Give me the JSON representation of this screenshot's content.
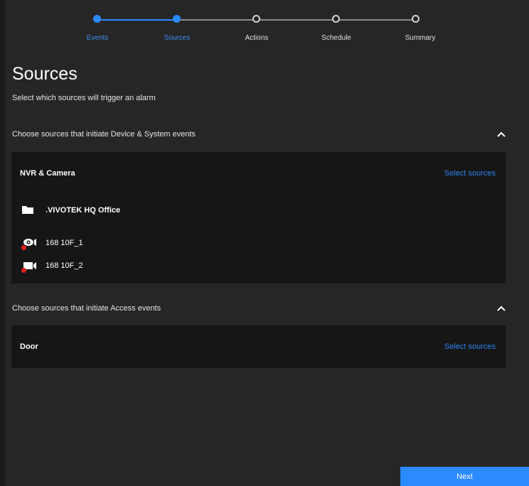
{
  "stepper": {
    "steps": [
      {
        "label": "Events",
        "state": "done"
      },
      {
        "label": "Sources",
        "state": "done"
      },
      {
        "label": "Actions",
        "state": "todo"
      },
      {
        "label": "Schedule",
        "state": "todo"
      },
      {
        "label": "Summary",
        "state": "todo"
      }
    ]
  },
  "page": {
    "title": "Sources",
    "subtitle": "Select which sources will trigger an alarm"
  },
  "device_section": {
    "header": "Choose sources that initiate Device & System events",
    "card_title": "NVR & Camera",
    "select_label": "Select sources",
    "folder": ".VIVOTEK HQ Office",
    "cameras": [
      {
        "name": "168 10F_1",
        "icon": "fisheye-camera-icon"
      },
      {
        "name": "168 10F_2",
        "icon": "video-camera-icon"
      }
    ]
  },
  "access_section": {
    "header": "Choose sources that initiate Access events",
    "card_title": "Door",
    "select_label": "Select sources"
  },
  "footer": {
    "next_label": "Next"
  },
  "colors": {
    "accent": "#2b8aff",
    "background": "#262626",
    "card": "#161616",
    "status_offline": "#e0201d"
  }
}
